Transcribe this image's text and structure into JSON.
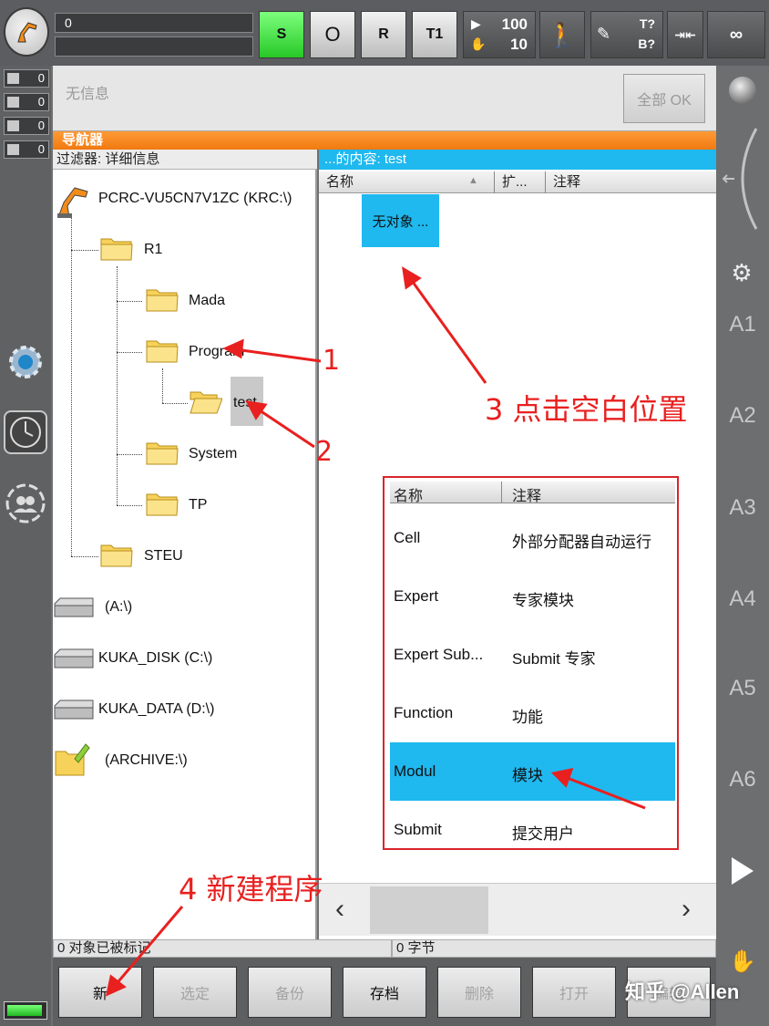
{
  "topbar": {
    "status_value": "0",
    "mode_buttons": [
      "S",
      "O",
      "R",
      "T1"
    ],
    "override": {
      "run": "100",
      "jog": "10"
    },
    "tool_base": {
      "t": "T?",
      "b": "B?"
    },
    "infinity": "∞"
  },
  "left_indicators": [
    "0",
    "0",
    "0",
    "0"
  ],
  "messages": {
    "text": "无信息",
    "ok_all": "全部 OK"
  },
  "navigator": {
    "title": "导航器",
    "filter_label": "过滤器: 详细信息",
    "tree": {
      "root": "PCRC-VU5CN7V1ZC (KRC:\\)",
      "r1": "R1",
      "mada": "Mada",
      "program": "Program",
      "test": "test",
      "system": "System",
      "tp": "TP",
      "steu": "STEU",
      "drive_a": "(A:\\)",
      "drive_c": "KUKA_DISK (C:\\)",
      "drive_d": "KUKA_DATA (D:\\)",
      "archive": "(ARCHIVE:\\)"
    },
    "content_header": "...的内容: test",
    "columns": {
      "name": "名称",
      "ext": "扩...",
      "comment": "注释"
    },
    "empty_label": "无对象 ...",
    "status_marked": "0 对象已被标记",
    "status_bytes": "0 字节",
    "scroll_left": "‹",
    "scroll_right": "›"
  },
  "template_popup": {
    "header": {
      "name": "名称",
      "comment": "注释"
    },
    "rows": [
      {
        "name": "Cell",
        "comment": "外部分配器自动运行"
      },
      {
        "name": "Expert",
        "comment": "专家模块"
      },
      {
        "name": "Expert Sub...",
        "comment": "Submit 专家"
      },
      {
        "name": "Function",
        "comment": "功能"
      },
      {
        "name": "Modul",
        "comment": "模块"
      },
      {
        "name": "Submit",
        "comment": "提交用户"
      }
    ],
    "selected_index": 4
  },
  "bottom_buttons": [
    "新",
    "选定",
    "备份",
    "存档",
    "删除",
    "打开",
    "编辑"
  ],
  "axes": [
    "A1",
    "A2",
    "A3",
    "A4",
    "A5",
    "A6"
  ],
  "annotations": {
    "a1": "1",
    "a2": "2",
    "a3": "3 点击空白位置",
    "a4": "4 新建程序"
  },
  "watermark": "知乎 @Allen",
  "colors": {
    "accent_blue": "#1fb8ef",
    "nav_orange": "#f58a1f",
    "annotation_red": "#e8201f"
  }
}
